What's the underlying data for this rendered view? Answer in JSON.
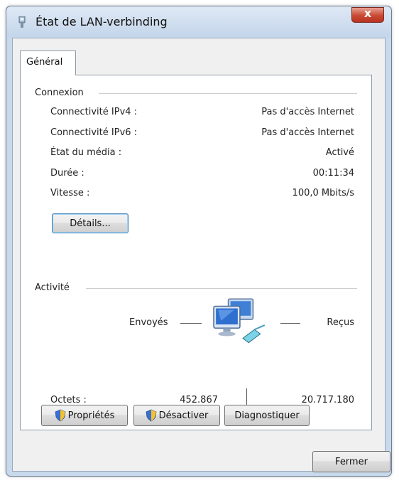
{
  "window": {
    "title": "État de LAN-verbinding",
    "close_glyph": "x"
  },
  "tabs": [
    {
      "label": "Général",
      "active": true
    }
  ],
  "connexion": {
    "group_label": "Connexion",
    "rows": [
      {
        "label": "Connectivité IPv4 :",
        "value": "Pas d'accès Internet"
      },
      {
        "label": "Connectivité IPv6 :",
        "value": "Pas d'accès Internet"
      },
      {
        "label": "État du média :",
        "value": "Activé"
      },
      {
        "label": "Durée :",
        "value": "00:11:34"
      },
      {
        "label": "Vitesse :",
        "value": "100,0 Mbits/s"
      }
    ],
    "details_button": "Détails..."
  },
  "activite": {
    "group_label": "Activité",
    "sent_label": "Envoyés",
    "received_label": "Reçus",
    "bytes_label": "Octets :",
    "bytes_sent": "452.867",
    "bytes_received": "20.717.180"
  },
  "buttons": {
    "properties": "Propriétés",
    "disable": "Désactiver",
    "diagnose": "Diagnostiquer",
    "close": "Fermer"
  },
  "icons": {
    "title": "network-adapter-icon",
    "activity": "network-computers-icon",
    "shield": "uac-shield-icon"
  },
  "colors": {
    "titlebar": "#c9d9ec",
    "close_button": "#c84a33",
    "client_bg": "#f0f0f0"
  }
}
